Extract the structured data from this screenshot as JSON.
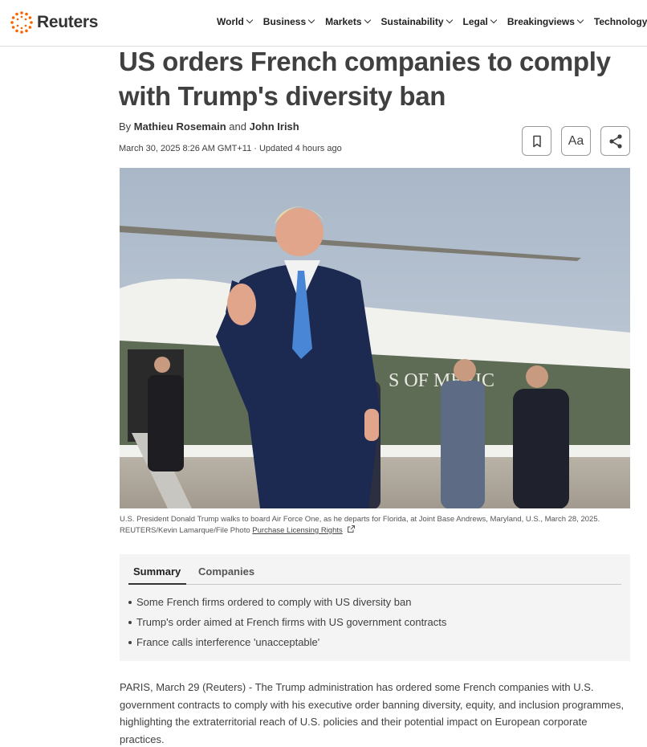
{
  "header": {
    "logo_text": "Reuters",
    "nav": [
      {
        "label": "World"
      },
      {
        "label": "Business"
      },
      {
        "label": "Markets"
      },
      {
        "label": "Sustainability"
      },
      {
        "label": "Legal"
      },
      {
        "label": "Breakingviews"
      },
      {
        "label": "Technology"
      }
    ]
  },
  "article": {
    "headline": "US orders French companies to comply with Trump's diversity ban",
    "byline_prefix": "By",
    "author1": "Mathieu Rosemain",
    "byline_and": "and",
    "author2": "John Irish",
    "dateline": "March 30, 2025 8:26 AM GMT+11 · Updated 4 hours ago",
    "tools": {
      "font_label": "Aa"
    },
    "photo_text": "S OF MERIC",
    "caption": "U.S. President Donald Trump walks to board Air Force One, as he departs for Florida, at Joint Base Andrews, Maryland, U.S., March 28, 2025. REUTERS/Kevin Lamarque/File Photo",
    "caption_link": "Purchase Licensing Rights",
    "summary": {
      "tabs": [
        "Summary",
        "Companies"
      ],
      "bullets": [
        "Some French firms ordered to comply with US diversity ban",
        "Trump's order aimed at French firms with US government contracts",
        "France calls interference 'unacceptable'"
      ]
    },
    "body": "PARIS, March 29 (Reuters) - The Trump administration has ordered some French companies with U.S. government contracts to comply with his executive order banning diversity, equity, and inclusion programmes, highlighting the extraterritorial reach of U.S. policies and their potential impact on European corporate practices."
  },
  "colors": {
    "brand_orange": "#fa6400",
    "text": "#404040",
    "summary_bg": "#f4f4f4"
  },
  "icons": [
    "reuters-logo-icon",
    "chevron-down-icon",
    "bookmark-icon",
    "share-icon",
    "external-link-icon"
  ]
}
